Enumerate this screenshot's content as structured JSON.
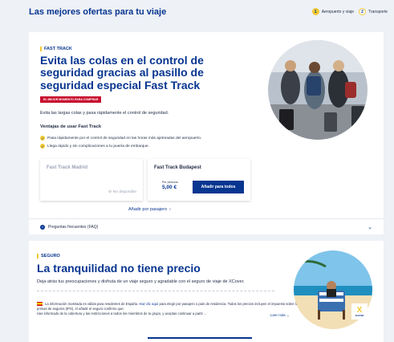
{
  "header": {
    "title": "Las mejores ofertas para tu viaje",
    "steps": [
      {
        "num": "1",
        "label": "Aeropuerto y viaje"
      },
      {
        "num": "2",
        "label": "Transporte"
      }
    ]
  },
  "fast_track": {
    "kicker": "FAST TRACK",
    "headline": "Evita las colas en el control de seguridad gracias al pasillo de seguridad especial Fast Track",
    "badge": "EL MEJOR MOMENTO PARA COMPRAR",
    "lead": "Evita las largas colas y pasa rápidamente el control de seguridad.",
    "benefits_title": "Ventajas de usar Fast Track",
    "benefits": [
      "Pasa rápidamente por el control de seguridad en las horas más ajetreadas del aeropuerto.",
      "Llega rápido y sin complicaciones a tu puerta de embarque."
    ],
    "options": [
      {
        "name": "Fast Track Madrid",
        "status": "No disponible"
      },
      {
        "name": "Fast Track Budapest",
        "per_person": "Por persona",
        "price": "5,00 €",
        "button": "Añadir para todos"
      }
    ],
    "per_passenger": "Añadir por pasajero",
    "faq": "Preguntas frecuentes (FAQ)"
  },
  "insurance": {
    "kicker": "SEGURO",
    "headline": "La tranquilidad no tiene precio",
    "lead": "Deja atrás tus preocupaciones y disfruta de un viaje seguro y agradable con el seguro de viaje de XCover.",
    "notice_start": "La información mostrada es válida para residentes de España.",
    "notice_link": "Haz clic aquí",
    "notice_end": "para elegir por pasajero o país de residencia. Todos los precios incluyen el impuesto sobre las primas de seguros (IPS). Al añadir el seguro confirmo que:",
    "notice_line2": "Has informado de la cobertura y las restricciones a todos los miembros de tu grupo, y aceptas continuar a partir ...",
    "read_more": "Leer más",
    "brand": "XCOVER"
  },
  "colors": {
    "brand_blue": "#073590",
    "accent_yellow": "#f1c933",
    "promo_red": "#c8102e"
  }
}
